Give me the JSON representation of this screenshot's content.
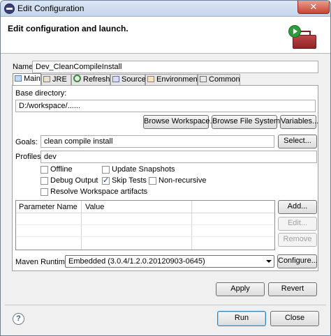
{
  "window": {
    "title": "Edit Configuration",
    "close_glyph": "✕"
  },
  "header": {
    "title": "Edit configuration and launch.",
    "icon": "run-toolbox-icon"
  },
  "name": {
    "label": "Name:",
    "value": "Dev_CleanCompileInstall"
  },
  "tabs": [
    {
      "label": "Main",
      "icon": "maven-main-icon",
      "active": true
    },
    {
      "label": "JRE",
      "icon": "jre-icon"
    },
    {
      "label": "Refresh",
      "icon": "refresh-icon"
    },
    {
      "label": "Source",
      "icon": "source-icon"
    },
    {
      "label": "Environment",
      "icon": "environment-icon"
    },
    {
      "label": "Common",
      "icon": "common-icon"
    }
  ],
  "main": {
    "base_directory_label": "Base directory:",
    "base_directory_value": "D:/workspace/......",
    "browse_workspace": "Browse Workspace...",
    "browse_file_system": "Browse File System...",
    "variables": "Variables...",
    "goals_label": "Goals:",
    "goals_value": "clean compile install",
    "select": "Select...",
    "profiles_label": "Profiles:",
    "profiles_value": "dev",
    "options": {
      "offline": {
        "label": "Offline",
        "checked": false
      },
      "update_snapshots": {
        "label": "Update Snapshots",
        "checked": false
      },
      "debug_output": {
        "label": "Debug Output",
        "checked": false
      },
      "skip_tests": {
        "label": "Skip Tests",
        "checked": true
      },
      "non_recursive": {
        "label": "Non-recursive",
        "checked": false
      },
      "resolve_workspace": {
        "label": "Resolve Workspace artifacts",
        "checked": false
      }
    },
    "params_table": {
      "columns": [
        "Parameter Name",
        "Value"
      ],
      "rows": []
    },
    "add": "Add...",
    "edit": "Edit...",
    "remove": "Remove",
    "maven_runtime_label": "Maven Runtime:",
    "maven_runtime_value": "Embedded (3.0.4/1.2.0.20120903-0645)",
    "configure": "Configure...",
    "apply": "Apply",
    "revert": "Revert"
  },
  "footer": {
    "help_glyph": "?",
    "run": "Run",
    "close": "Close"
  }
}
